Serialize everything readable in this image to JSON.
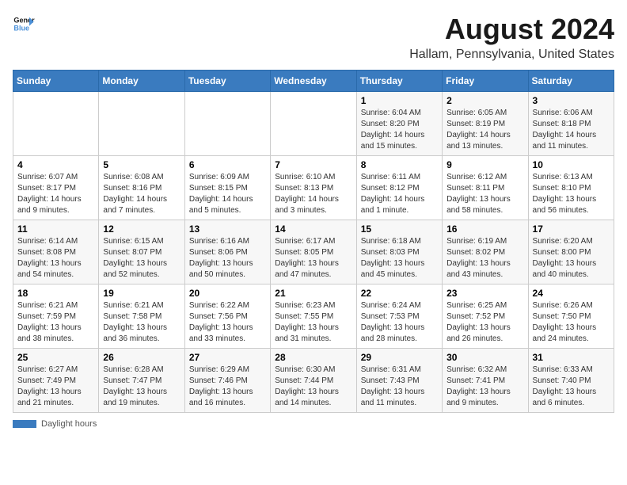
{
  "header": {
    "logo_line1": "General",
    "logo_line2": "Blue",
    "title": "August 2024",
    "subtitle": "Hallam, Pennsylvania, United States"
  },
  "days_of_week": [
    "Sunday",
    "Monday",
    "Tuesday",
    "Wednesday",
    "Thursday",
    "Friday",
    "Saturday"
  ],
  "weeks": [
    [
      {
        "day": "",
        "info": ""
      },
      {
        "day": "",
        "info": ""
      },
      {
        "day": "",
        "info": ""
      },
      {
        "day": "",
        "info": ""
      },
      {
        "day": "1",
        "info": "Sunrise: 6:04 AM\nSunset: 8:20 PM\nDaylight: 14 hours and 15 minutes."
      },
      {
        "day": "2",
        "info": "Sunrise: 6:05 AM\nSunset: 8:19 PM\nDaylight: 14 hours and 13 minutes."
      },
      {
        "day": "3",
        "info": "Sunrise: 6:06 AM\nSunset: 8:18 PM\nDaylight: 14 hours and 11 minutes."
      }
    ],
    [
      {
        "day": "4",
        "info": "Sunrise: 6:07 AM\nSunset: 8:17 PM\nDaylight: 14 hours and 9 minutes."
      },
      {
        "day": "5",
        "info": "Sunrise: 6:08 AM\nSunset: 8:16 PM\nDaylight: 14 hours and 7 minutes."
      },
      {
        "day": "6",
        "info": "Sunrise: 6:09 AM\nSunset: 8:15 PM\nDaylight: 14 hours and 5 minutes."
      },
      {
        "day": "7",
        "info": "Sunrise: 6:10 AM\nSunset: 8:13 PM\nDaylight: 14 hours and 3 minutes."
      },
      {
        "day": "8",
        "info": "Sunrise: 6:11 AM\nSunset: 8:12 PM\nDaylight: 14 hours and 1 minute."
      },
      {
        "day": "9",
        "info": "Sunrise: 6:12 AM\nSunset: 8:11 PM\nDaylight: 13 hours and 58 minutes."
      },
      {
        "day": "10",
        "info": "Sunrise: 6:13 AM\nSunset: 8:10 PM\nDaylight: 13 hours and 56 minutes."
      }
    ],
    [
      {
        "day": "11",
        "info": "Sunrise: 6:14 AM\nSunset: 8:08 PM\nDaylight: 13 hours and 54 minutes."
      },
      {
        "day": "12",
        "info": "Sunrise: 6:15 AM\nSunset: 8:07 PM\nDaylight: 13 hours and 52 minutes."
      },
      {
        "day": "13",
        "info": "Sunrise: 6:16 AM\nSunset: 8:06 PM\nDaylight: 13 hours and 50 minutes."
      },
      {
        "day": "14",
        "info": "Sunrise: 6:17 AM\nSunset: 8:05 PM\nDaylight: 13 hours and 47 minutes."
      },
      {
        "day": "15",
        "info": "Sunrise: 6:18 AM\nSunset: 8:03 PM\nDaylight: 13 hours and 45 minutes."
      },
      {
        "day": "16",
        "info": "Sunrise: 6:19 AM\nSunset: 8:02 PM\nDaylight: 13 hours and 43 minutes."
      },
      {
        "day": "17",
        "info": "Sunrise: 6:20 AM\nSunset: 8:00 PM\nDaylight: 13 hours and 40 minutes."
      }
    ],
    [
      {
        "day": "18",
        "info": "Sunrise: 6:21 AM\nSunset: 7:59 PM\nDaylight: 13 hours and 38 minutes."
      },
      {
        "day": "19",
        "info": "Sunrise: 6:21 AM\nSunset: 7:58 PM\nDaylight: 13 hours and 36 minutes."
      },
      {
        "day": "20",
        "info": "Sunrise: 6:22 AM\nSunset: 7:56 PM\nDaylight: 13 hours and 33 minutes."
      },
      {
        "day": "21",
        "info": "Sunrise: 6:23 AM\nSunset: 7:55 PM\nDaylight: 13 hours and 31 minutes."
      },
      {
        "day": "22",
        "info": "Sunrise: 6:24 AM\nSunset: 7:53 PM\nDaylight: 13 hours and 28 minutes."
      },
      {
        "day": "23",
        "info": "Sunrise: 6:25 AM\nSunset: 7:52 PM\nDaylight: 13 hours and 26 minutes."
      },
      {
        "day": "24",
        "info": "Sunrise: 6:26 AM\nSunset: 7:50 PM\nDaylight: 13 hours and 24 minutes."
      }
    ],
    [
      {
        "day": "25",
        "info": "Sunrise: 6:27 AM\nSunset: 7:49 PM\nDaylight: 13 hours and 21 minutes."
      },
      {
        "day": "26",
        "info": "Sunrise: 6:28 AM\nSunset: 7:47 PM\nDaylight: 13 hours and 19 minutes."
      },
      {
        "day": "27",
        "info": "Sunrise: 6:29 AM\nSunset: 7:46 PM\nDaylight: 13 hours and 16 minutes."
      },
      {
        "day": "28",
        "info": "Sunrise: 6:30 AM\nSunset: 7:44 PM\nDaylight: 13 hours and 14 minutes."
      },
      {
        "day": "29",
        "info": "Sunrise: 6:31 AM\nSunset: 7:43 PM\nDaylight: 13 hours and 11 minutes."
      },
      {
        "day": "30",
        "info": "Sunrise: 6:32 AM\nSunset: 7:41 PM\nDaylight: 13 hours and 9 minutes."
      },
      {
        "day": "31",
        "info": "Sunrise: 6:33 AM\nSunset: 7:40 PM\nDaylight: 13 hours and 6 minutes."
      }
    ]
  ],
  "footer": {
    "label": "Daylight hours"
  }
}
